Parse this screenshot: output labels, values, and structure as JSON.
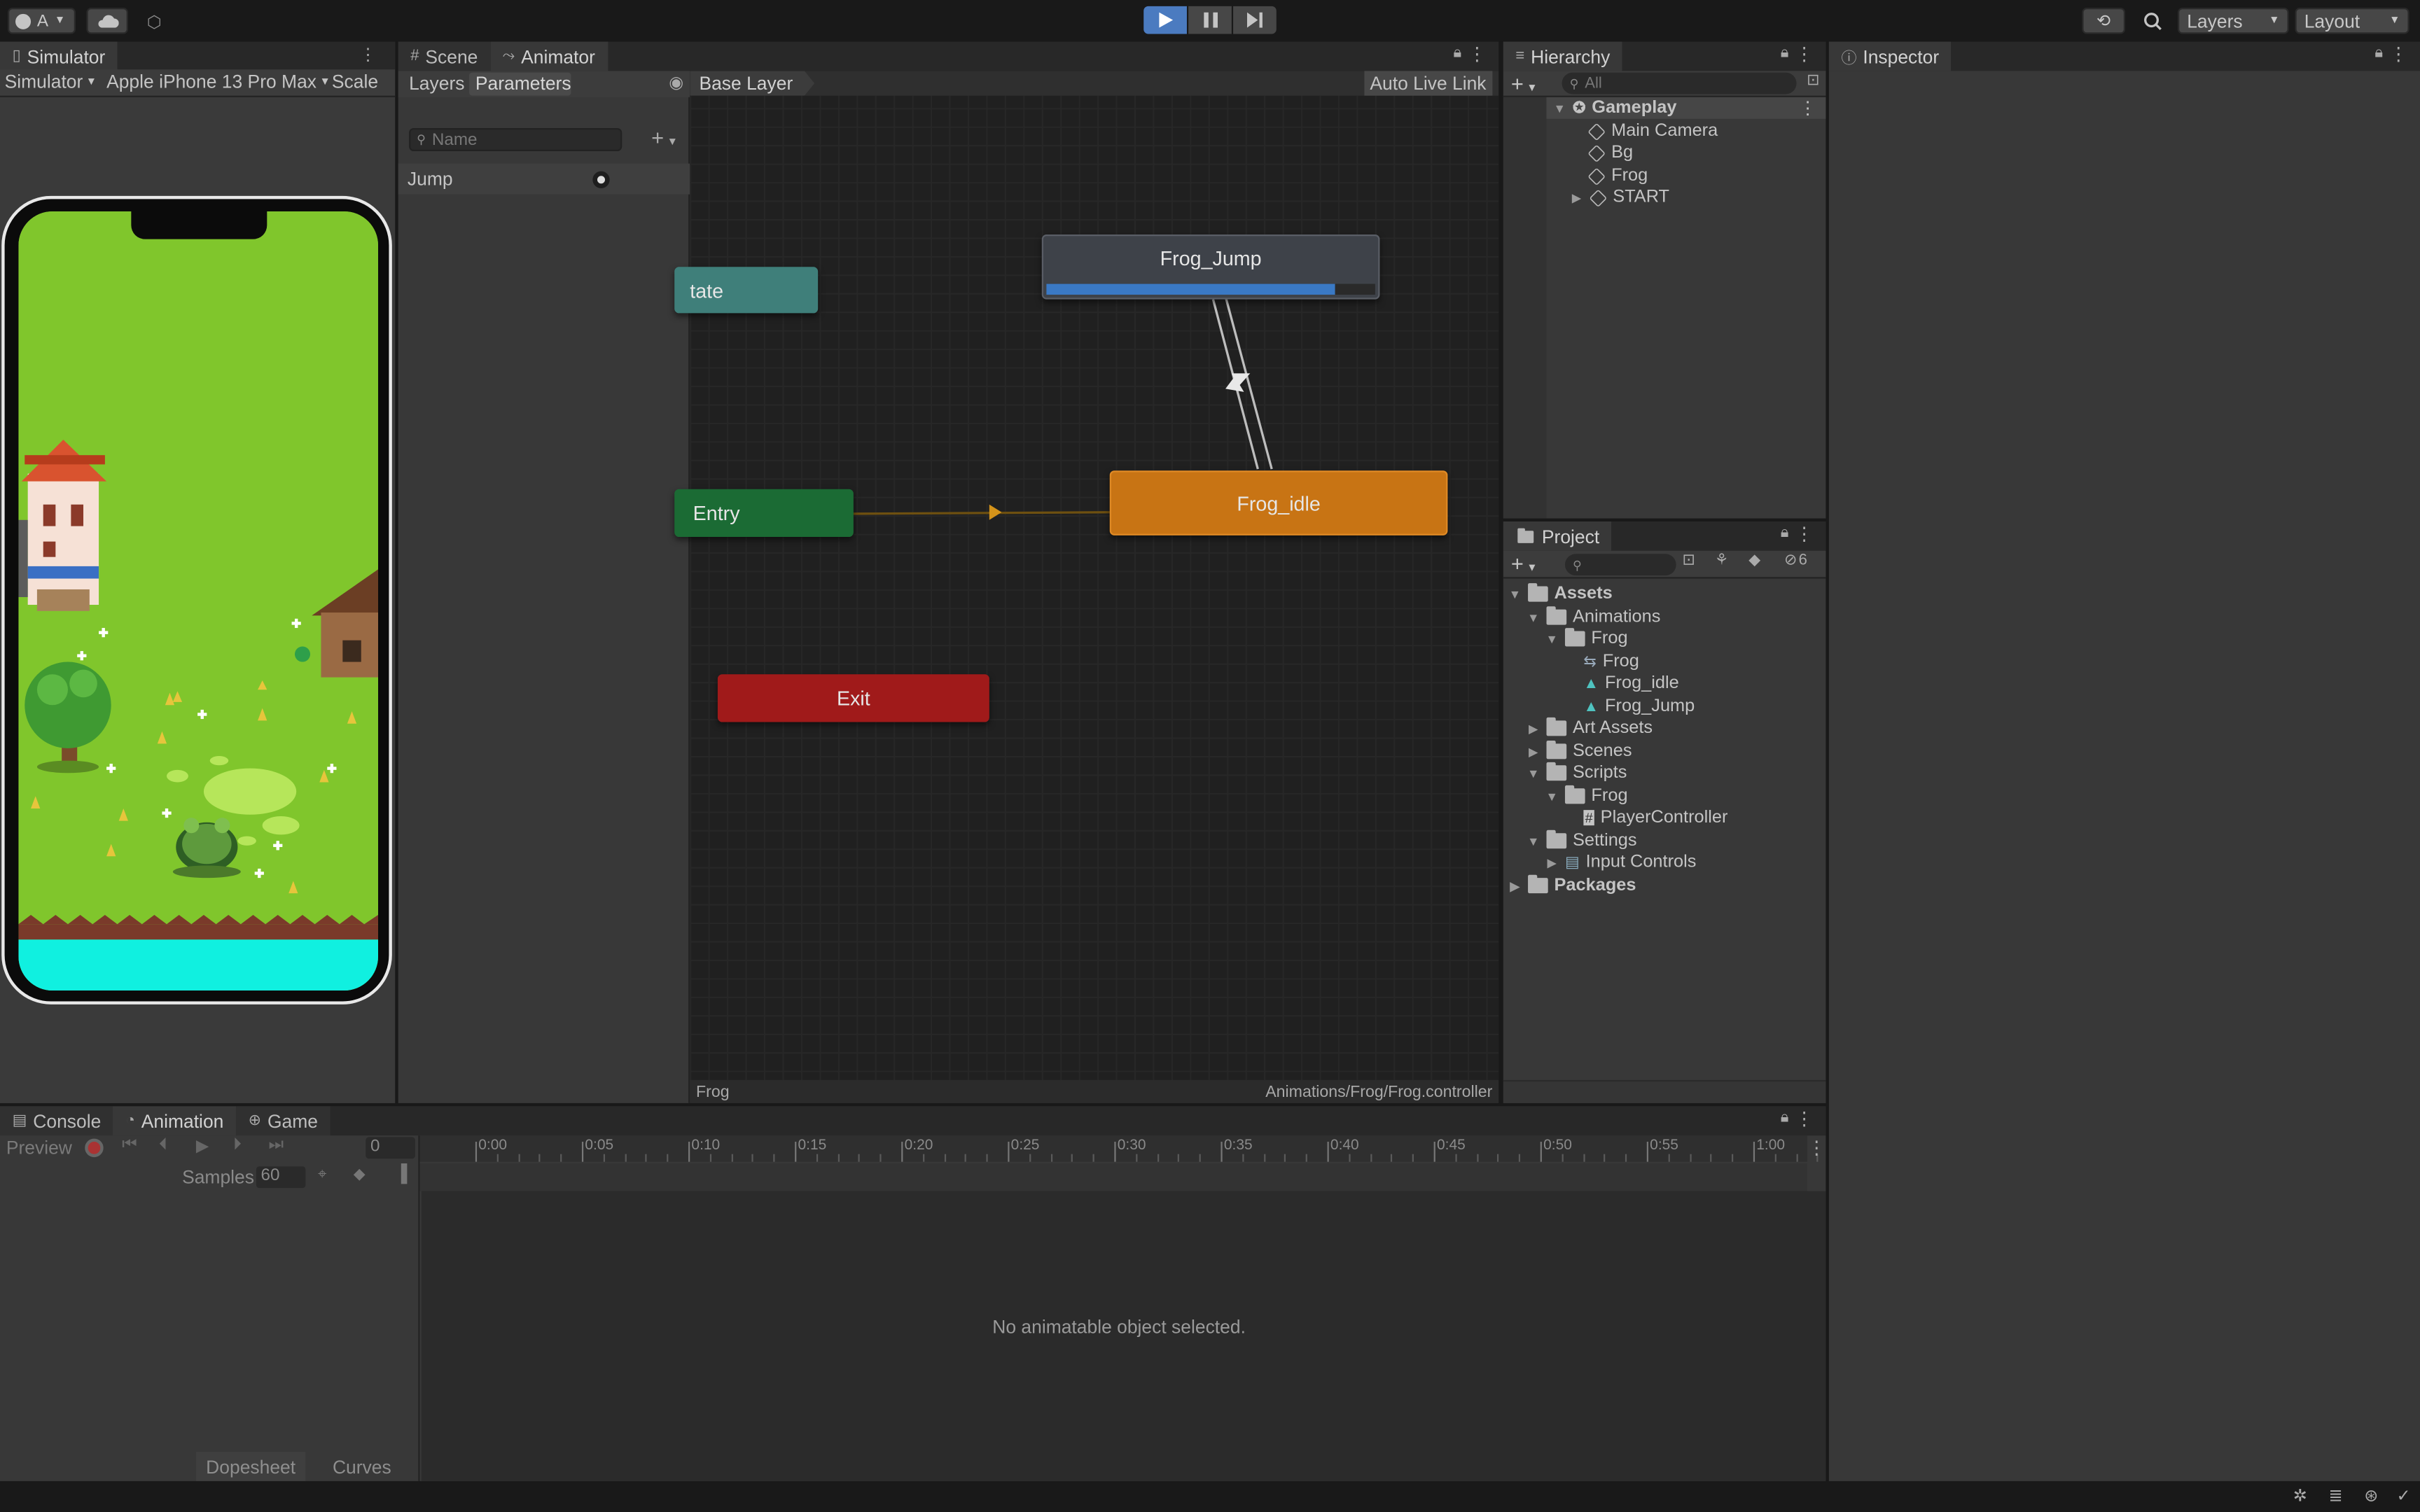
{
  "topbar": {
    "account_label": "A",
    "layers_label": "Layers",
    "layout_label": "Layout"
  },
  "simulator": {
    "tab_label": "Simulator",
    "mode_label": "Simulator",
    "device_label": "Apple iPhone 13 Pro Max",
    "scale_label": "Scale"
  },
  "animator": {
    "scene_tab": "Scene",
    "animator_tab": "Animator",
    "layers_tab": "Layers",
    "parameters_tab": "Parameters",
    "search_placeholder": "Name",
    "parameter_name": "Jump",
    "breadcrumb": "Base Layer",
    "auto_live_link": "Auto Live Link",
    "nodes": {
      "any_state": "tate",
      "entry": "Entry",
      "exit": "Exit",
      "frog_jump": "Frog_Jump",
      "frog_idle": "Frog_idle"
    },
    "frog_jump_progress": 0.88,
    "footer_left": "Frog",
    "footer_right": "Animations/Frog/Frog.controller"
  },
  "hierarchy": {
    "tab_label": "Hierarchy",
    "search_placeholder": "All",
    "scene_name": "Gameplay",
    "items": [
      {
        "label": "Main Camera"
      },
      {
        "label": "Bg"
      },
      {
        "label": "Frog"
      },
      {
        "label": "START"
      }
    ]
  },
  "inspector": {
    "tab_label": "Inspector"
  },
  "project": {
    "tab_label": "Project",
    "hidden_count": "6",
    "tree": [
      {
        "label": "Assets",
        "bold": true
      },
      {
        "label": "Animations"
      },
      {
        "label": "Frog"
      },
      {
        "label": "Frog"
      },
      {
        "label": "Frog_idle"
      },
      {
        "label": "Frog_Jump"
      },
      {
        "label": "Art Assets"
      },
      {
        "label": "Scenes"
      },
      {
        "label": "Scripts"
      },
      {
        "label": "Frog"
      },
      {
        "label": "PlayerController"
      },
      {
        "label": "Settings"
      },
      {
        "label": "Input Controls"
      },
      {
        "label": "Packages",
        "bold": true
      }
    ]
  },
  "bottom": {
    "console_tab": "Console",
    "animation_tab": "Animation",
    "game_tab": "Game",
    "preview_label": "Preview",
    "frame_value": "0",
    "samples_label": "Samples",
    "samples_value": "60",
    "timeline_ticks": [
      "0:00",
      "0:05",
      "0:10",
      "0:15",
      "0:20",
      "0:25",
      "0:30",
      "0:35",
      "0:40",
      "0:45",
      "0:50",
      "0:55",
      "1:00"
    ],
    "empty_message": "No animatable object selected.",
    "dopesheet_label": "Dopesheet",
    "curves_label": "Curves"
  },
  "colors": {
    "accent_blue": "#3a79c5",
    "entry_green": "#1b6b34",
    "exit_red": "#a01a1a",
    "idle_orange": "#c87414",
    "anystate_teal": "#3f7f7a"
  }
}
